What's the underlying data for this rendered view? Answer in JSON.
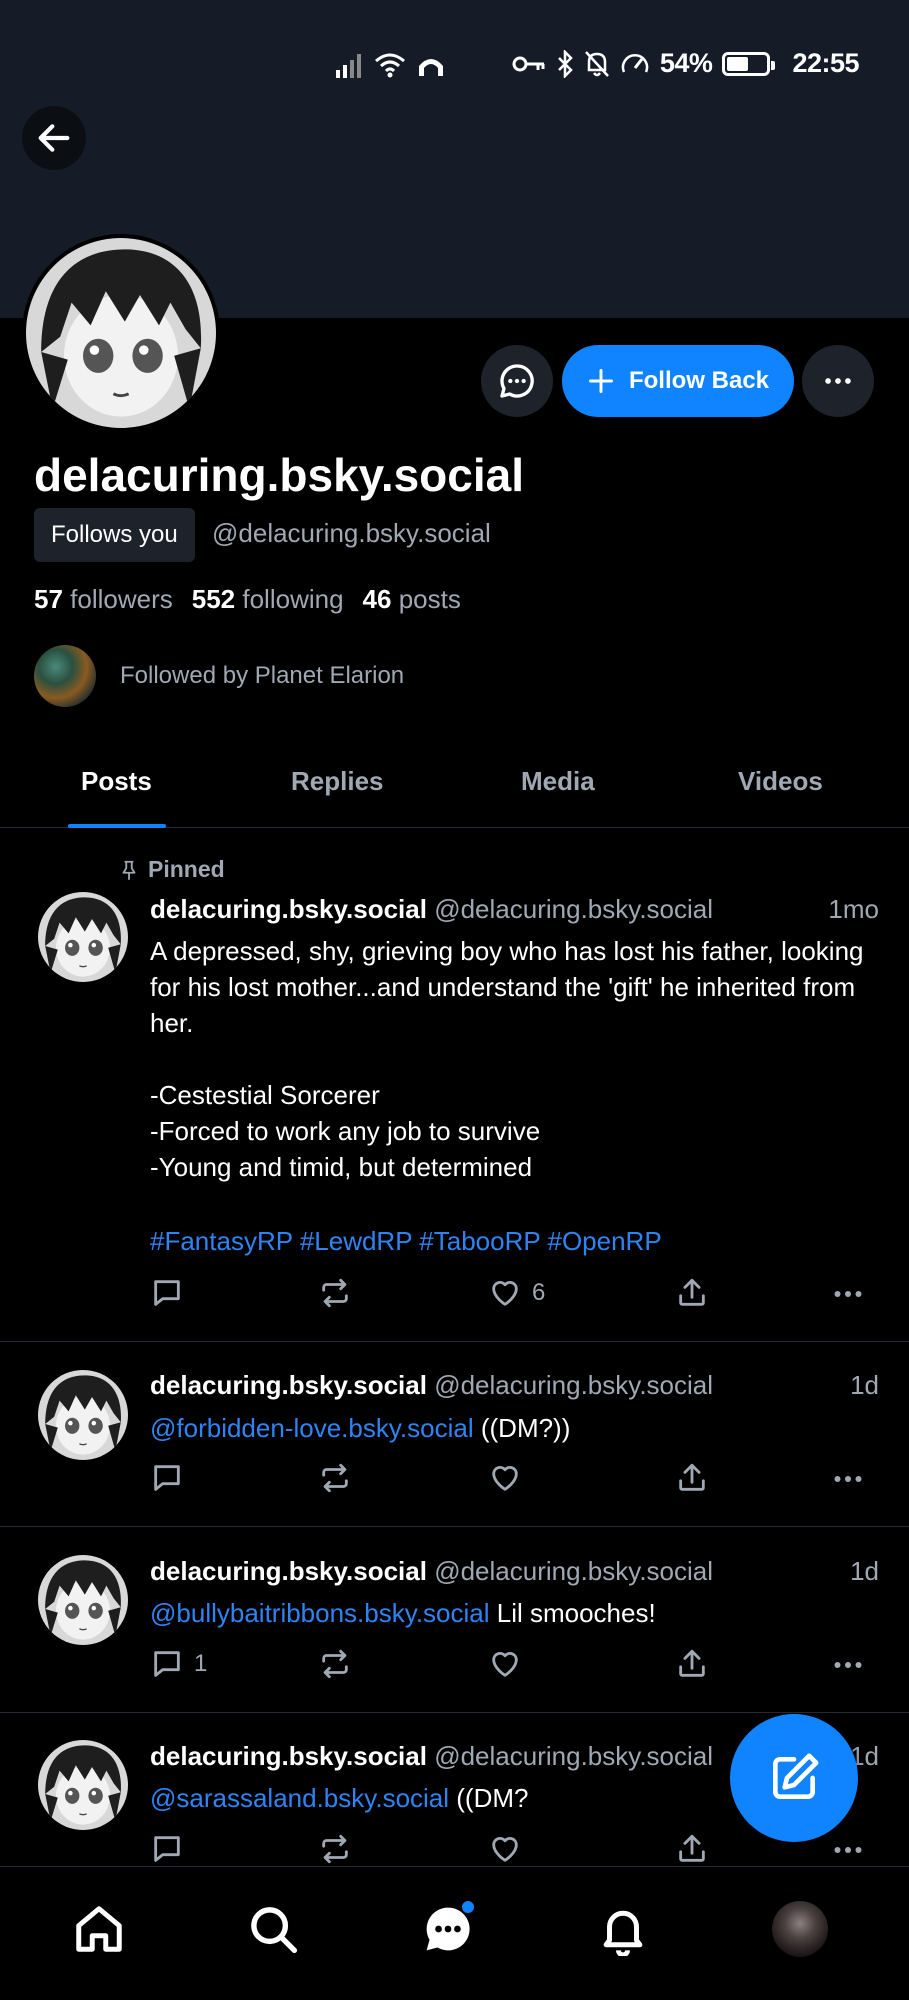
{
  "status_bar": {
    "battery": "54%",
    "battery_level": 0.54,
    "time": "22:55"
  },
  "profile": {
    "display_name": "delacuring.bsky.social",
    "follows_you": "Follows you",
    "handle": "@delacuring.bsky.social",
    "stats": [
      {
        "num": "57",
        "label": "followers"
      },
      {
        "num": "552",
        "label": "following"
      },
      {
        "num": "46",
        "label": "posts"
      }
    ],
    "followed_by": "Followed by Planet Elarion"
  },
  "actions": {
    "follow_back": "Follow Back"
  },
  "tabs": [
    "Posts",
    "Replies",
    "Media",
    "Videos"
  ],
  "active_tab": "Posts",
  "pinned_label": "Pinned",
  "posts": [
    {
      "name": "delacuring.bsky.social",
      "handle": "@delacuring.bsky.social",
      "time": "1mo",
      "text": "A depressed, shy, grieving boy who has lost his father, looking for his lost mother...and understand the 'gift' he inherited from her.\n\n-Cestestial Sorcerer\n-Forced to work any job to survive\n-Young and timid, but determined",
      "hashtags": "#FantasyRP #LewdRP #TabooRP #OpenRP",
      "likes": "6"
    },
    {
      "name": "delacuring.bsky.social",
      "handle": "@delacuring.bsky.social",
      "time": "1d",
      "mention": "@forbidden-love.bsky.social",
      "text": " ((DM?))"
    },
    {
      "name": "delacuring.bsky.social",
      "handle": "@delacuring.bsky.social",
      "time": "1d",
      "mention": "@bullybaitribbons.bsky.social",
      "text": " Lil smooches!",
      "replies": "1"
    },
    {
      "name": "delacuring.bsky.social",
      "handle": "@delacuring.bsky.social",
      "time": "1d",
      "mention": "@sarassaland.bsky.social",
      "text": " ((DM?"
    }
  ],
  "colors": {
    "accent": "#1083fe",
    "link": "#2f84f5",
    "muted": "#a0a8b4",
    "banner": "#161c27"
  },
  "icons": [
    "back-arrow-icon",
    "chat-icon",
    "plus-icon",
    "more-icon",
    "pin-icon",
    "reply-icon",
    "repost-icon",
    "like-icon",
    "share-icon",
    "home-icon",
    "search-icon",
    "messages-icon",
    "bell-icon",
    "compose-icon"
  ]
}
